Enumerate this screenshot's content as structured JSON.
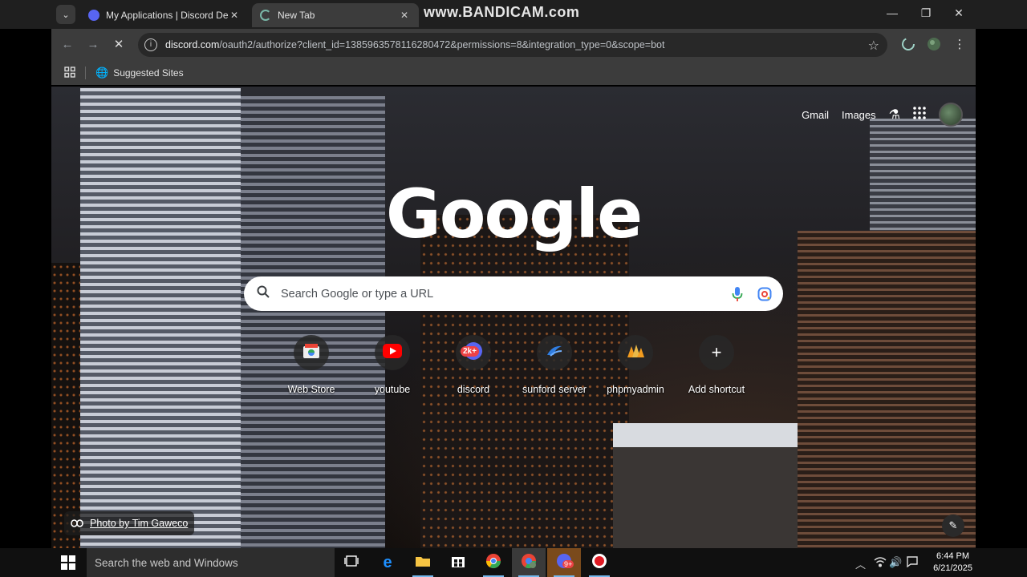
{
  "overlay": {
    "watermark": "www.BANDICAM.com"
  },
  "tabs": [
    {
      "title": "My Applications | Discord Developer Portal",
      "favicon": "discord-icon",
      "close": "✕"
    },
    {
      "title": "New Tab",
      "favicon": "loading-spinner-icon",
      "close": "✕"
    }
  ],
  "window_controls": {
    "minimize": "—",
    "maximize": "❐",
    "close": "✕"
  },
  "address_bar": {
    "host": "discord.com",
    "path": "/oauth2/authorize?client_id=1385963578116280472&permissions=8&integration_type=0&scope=bot"
  },
  "bookmarks": {
    "suggested_sites": "Suggested Sites"
  },
  "newtab": {
    "top_links": {
      "gmail": "Gmail",
      "images": "Images"
    },
    "logo": "Google",
    "search_placeholder": "Search Google or type a URL",
    "shortcuts": [
      {
        "label": "Web Store",
        "icon": "web-store-icon"
      },
      {
        "label": "youtube",
        "icon": "youtube-icon"
      },
      {
        "label": "discord",
        "icon": "discord-icon",
        "badge": "2k+"
      },
      {
        "label": "sunford server",
        "icon": "sunford-icon"
      },
      {
        "label": "phpmyadmin",
        "icon": "phpmyadmin-icon"
      },
      {
        "label": "Add shortcut",
        "icon": "plus-icon"
      }
    ],
    "photo_credit": "Photo by Tim Gaweco"
  },
  "taskbar": {
    "search_placeholder": "Search the web and Windows",
    "discord_badge": "9+",
    "time": "6:44 PM",
    "date": "6/21/2025"
  },
  "colors": {
    "chrome_dark": "#3c3c3c",
    "tab_bar": "#1f1f1f",
    "taskbar": "#101010",
    "accent": "#76b9ed"
  }
}
